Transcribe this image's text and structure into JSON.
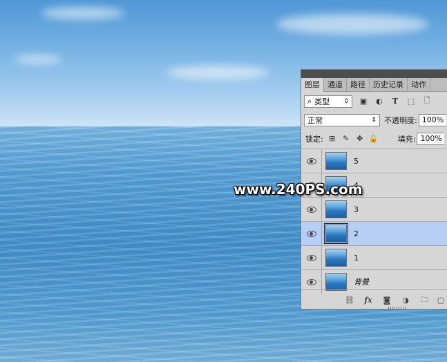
{
  "panel": {
    "tabs": [
      "图层",
      "通道",
      "路径",
      "历史记录",
      "动作"
    ],
    "filter": {
      "icon": "search-icon",
      "value": "类型"
    },
    "blend_mode": "正常",
    "opacity_label": "不透明度:",
    "opacity_value": "100%",
    "lock_label": "锁定:",
    "fill_label": "填充:",
    "fill_value": "100%",
    "layers": [
      {
        "name": "5",
        "selected": false
      },
      {
        "name": "4",
        "selected": false
      },
      {
        "name": "3",
        "selected": false
      },
      {
        "name": "2",
        "selected": true
      },
      {
        "name": "1",
        "selected": false
      },
      {
        "name": "背景",
        "selected": false
      }
    ],
    "footer_fx": "fx"
  },
  "watermark": "www.240PS.com"
}
